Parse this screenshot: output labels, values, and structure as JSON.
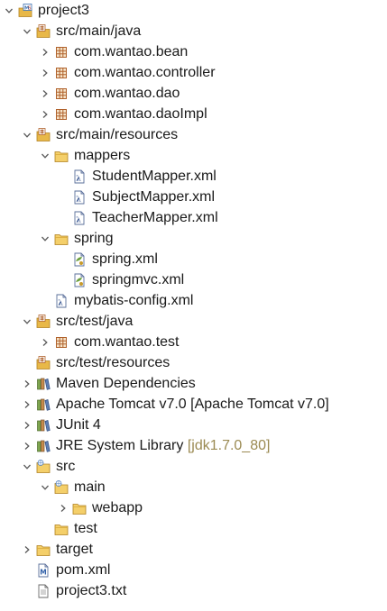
{
  "tree": {
    "nodes": [
      {
        "label": "project3",
        "icon": "maven-project-icon",
        "toggle": "expanded",
        "depth": 0
      },
      {
        "label": "src/main/java",
        "icon": "source-folder-icon",
        "toggle": "expanded",
        "depth": 1
      },
      {
        "label": "com.wantao.bean",
        "icon": "package-icon",
        "toggle": "collapsed",
        "depth": 2
      },
      {
        "label": "com.wantao.controller",
        "icon": "package-icon",
        "toggle": "collapsed",
        "depth": 2
      },
      {
        "label": "com.wantao.dao",
        "icon": "package-icon",
        "toggle": "collapsed",
        "depth": 2
      },
      {
        "label": "com.wantao.daoImpl",
        "icon": "package-icon",
        "toggle": "collapsed",
        "depth": 2
      },
      {
        "label": "src/main/resources",
        "icon": "source-folder-icon",
        "toggle": "expanded",
        "depth": 1
      },
      {
        "label": "mappers",
        "icon": "folder-icon",
        "toggle": "expanded",
        "depth": 2
      },
      {
        "label": "StudentMapper.xml",
        "icon": "mybatis-xml-icon",
        "toggle": "none",
        "depth": 3
      },
      {
        "label": "SubjectMapper.xml",
        "icon": "mybatis-xml-icon",
        "toggle": "none",
        "depth": 3
      },
      {
        "label": "TeacherMapper.xml",
        "icon": "mybatis-xml-icon",
        "toggle": "none",
        "depth": 3
      },
      {
        "label": "spring",
        "icon": "folder-icon",
        "toggle": "expanded",
        "depth": 2
      },
      {
        "label": "spring.xml",
        "icon": "spring-xml-icon",
        "toggle": "none",
        "depth": 3
      },
      {
        "label": "springmvc.xml",
        "icon": "spring-xml-icon",
        "toggle": "none",
        "depth": 3
      },
      {
        "label": "mybatis-config.xml",
        "icon": "mybatis-xml-icon",
        "toggle": "none",
        "depth": 2
      },
      {
        "label": "src/test/java",
        "icon": "source-folder-icon",
        "toggle": "expanded",
        "depth": 1
      },
      {
        "label": "com.wantao.test",
        "icon": "package-icon",
        "toggle": "collapsed",
        "depth": 2
      },
      {
        "label": "src/test/resources",
        "icon": "source-folder-icon",
        "toggle": "none",
        "depth": 1
      },
      {
        "label": "Maven Dependencies",
        "icon": "library-icon",
        "toggle": "collapsed",
        "depth": 1
      },
      {
        "label": "Apache Tomcat v7.0 [Apache Tomcat v7.0]",
        "icon": "library-icon",
        "toggle": "collapsed",
        "depth": 1
      },
      {
        "label": "JUnit 4",
        "icon": "library-icon",
        "toggle": "collapsed",
        "depth": 1
      },
      {
        "label": "JRE System Library",
        "decoration": "[jdk1.7.0_80]",
        "icon": "library-icon",
        "toggle": "collapsed",
        "depth": 1
      },
      {
        "label": "src",
        "icon": "web-folder-icon",
        "toggle": "expanded",
        "depth": 1
      },
      {
        "label": "main",
        "icon": "web-folder-icon",
        "toggle": "expanded",
        "depth": 2
      },
      {
        "label": "webapp",
        "icon": "folder-icon",
        "toggle": "collapsed",
        "depth": 3
      },
      {
        "label": "test",
        "icon": "folder-icon",
        "toggle": "none",
        "depth": 2
      },
      {
        "label": "target",
        "icon": "folder-icon",
        "toggle": "collapsed",
        "depth": 1
      },
      {
        "label": "pom.xml",
        "icon": "maven-pom-icon",
        "toggle": "none",
        "depth": 1
      },
      {
        "label": "project3.txt",
        "icon": "text-file-icon",
        "toggle": "none",
        "depth": 1
      }
    ]
  },
  "colors": {
    "package": "#b0622c",
    "folder": "#e8b848",
    "library": "#7a5230",
    "decoration": "#9b8a52",
    "arrow": "#5a5a5a"
  }
}
